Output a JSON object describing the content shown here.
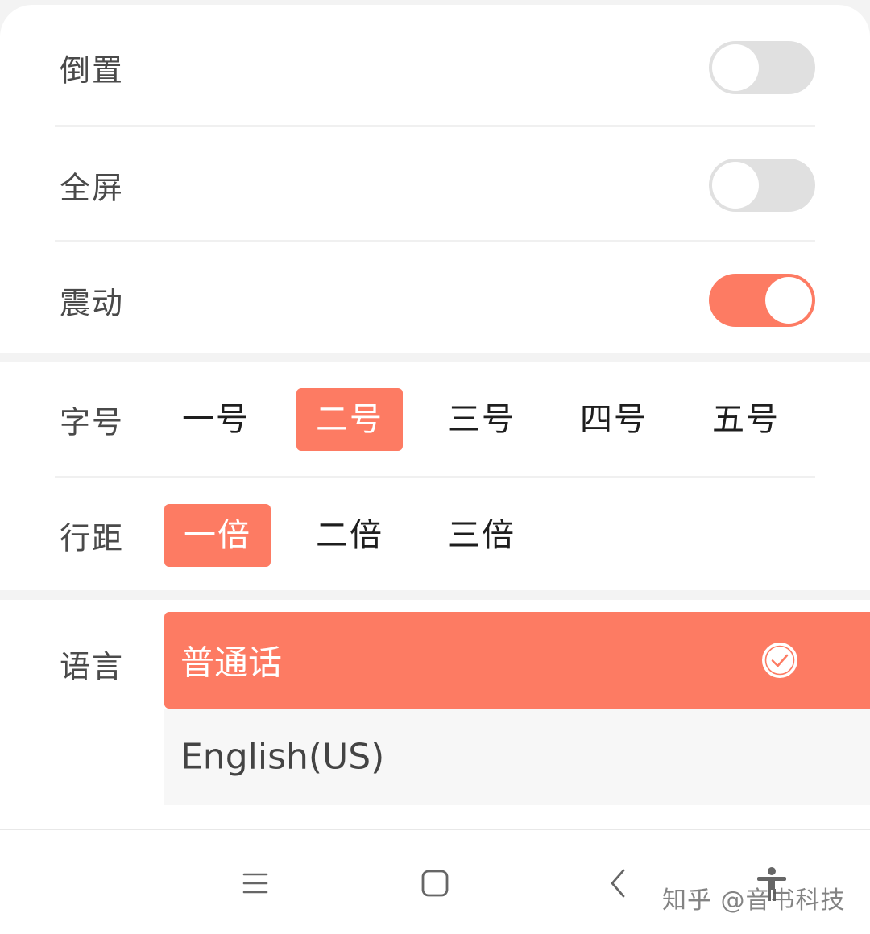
{
  "colors": {
    "accent": "#fd7b63",
    "switch_off": "#e0e0e0",
    "label_text": "#4a4a4a"
  },
  "toggles": [
    {
      "label": "倒置",
      "on": false
    },
    {
      "label": "全屏",
      "on": false
    },
    {
      "label": "震动",
      "on": true
    }
  ],
  "font_size": {
    "label": "字号",
    "options": [
      "一号",
      "二号",
      "三号",
      "四号",
      "五号"
    ],
    "selected": "二号"
  },
  "line_spacing": {
    "label": "行距",
    "options": [
      "一倍",
      "二倍",
      "三倍"
    ],
    "selected": "一倍"
  },
  "language": {
    "label": "语言",
    "options": [
      "普通话",
      "English(US)"
    ],
    "selected": "普通话",
    "selected_icon": "check-circle-icon"
  },
  "navbar": {
    "buttons": [
      "menu-icon",
      "home-icon",
      "back-icon",
      "accessibility-icon"
    ]
  },
  "watermark": "知乎 @音书科技"
}
